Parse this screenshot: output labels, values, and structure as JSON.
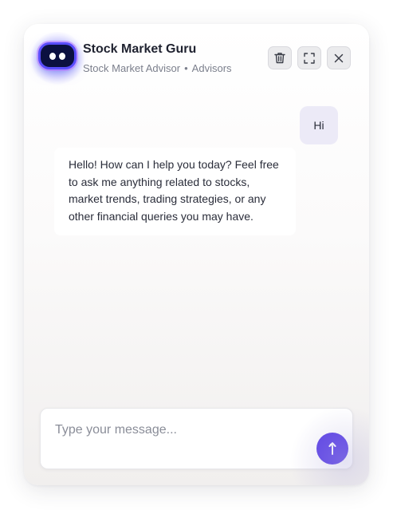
{
  "header": {
    "title": "Stock Market Guru",
    "subtitle_role": "Stock Market Advisor",
    "subtitle_separator": "•",
    "subtitle_category": "Advisors",
    "buttons": [
      "trash-icon",
      "expand-icon",
      "close-icon"
    ]
  },
  "messages": [
    {
      "sender": "user",
      "text": "Hi"
    },
    {
      "sender": "assistant",
      "text": "Hello! How can I help you today? Feel free to ask me anything related to stocks, market trends, trading strategies, or any other financial queries you may have."
    }
  ],
  "composer": {
    "placeholder": "Type your message...",
    "value": "",
    "send_icon": "arrow-up-icon"
  },
  "colors": {
    "accent": "#5a3fe6",
    "user_bubble": "#eceaf7",
    "avatar_bg": "#0b1040"
  }
}
